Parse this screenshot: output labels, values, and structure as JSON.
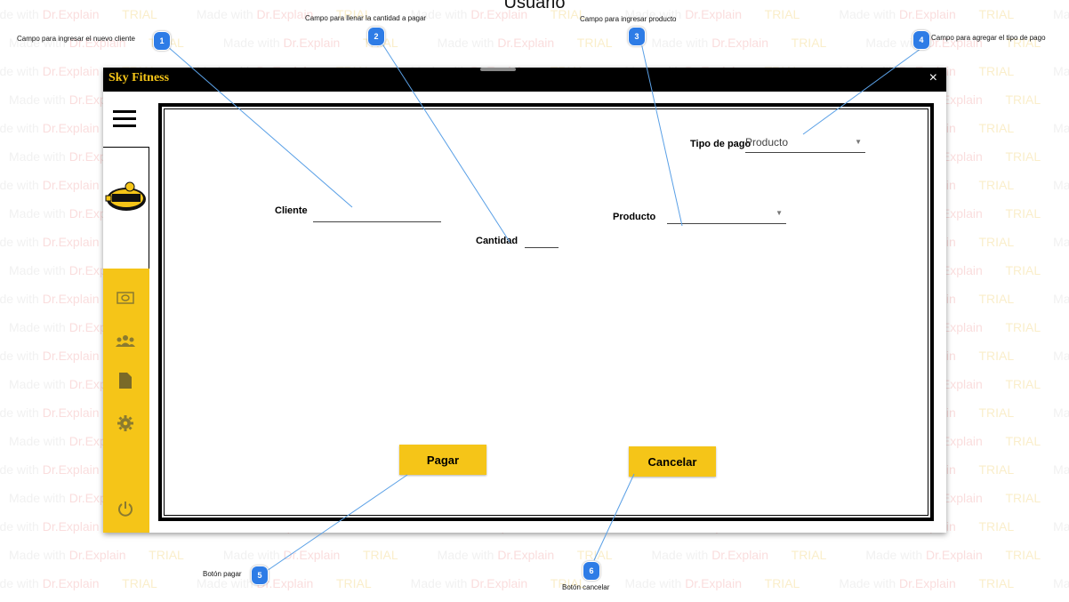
{
  "page": {
    "title": "Usuario"
  },
  "watermark": {
    "made": "Made with ",
    "dr": "Dr.Explain",
    "trial": " TRIAL"
  },
  "window": {
    "title": "Sky Fitness",
    "close": "×"
  },
  "sidebar": {
    "menu_icon": "hamburger-menu-icon",
    "logo": "sky-fitness-logo",
    "nav_items": [
      {
        "name": "payments",
        "icon": "money-icon"
      },
      {
        "name": "clients",
        "icon": "users-group-icon"
      },
      {
        "name": "reports",
        "icon": "document-icon"
      },
      {
        "name": "settings",
        "icon": "gear-icon"
      },
      {
        "name": "power",
        "icon": "power-icon"
      }
    ],
    "accent": "#f5c518"
  },
  "form": {
    "cliente_label": "Cliente",
    "cliente_value": "",
    "cantidad_label": "Cantidad",
    "cantidad_value": "",
    "producto_label": "Producto",
    "producto_value": "",
    "tipo_pago_label": "Tipo de pago",
    "tipo_pago_value": "Producto",
    "pagar_label": "Pagar",
    "cancelar_label": "Cancelar"
  },
  "callouts": [
    {
      "number": "1",
      "text": "Campo para ingresar el nuevo cliente"
    },
    {
      "number": "2",
      "text": "Campo para llenar la cantidad a pagar"
    },
    {
      "number": "3",
      "text": "Campo para ingresar producto"
    },
    {
      "number": "4",
      "text": "Campo para agregar el tipo de pago"
    },
    {
      "number": "5",
      "text": "Botón pagar"
    },
    {
      "number": "6",
      "text": "Botón cancelar"
    }
  ],
  "colors": {
    "accent_yellow": "#f5c518",
    "titlebar": "#000000",
    "badge_blue": "#2e7ce6",
    "callout_line": "#5aa0e6"
  }
}
